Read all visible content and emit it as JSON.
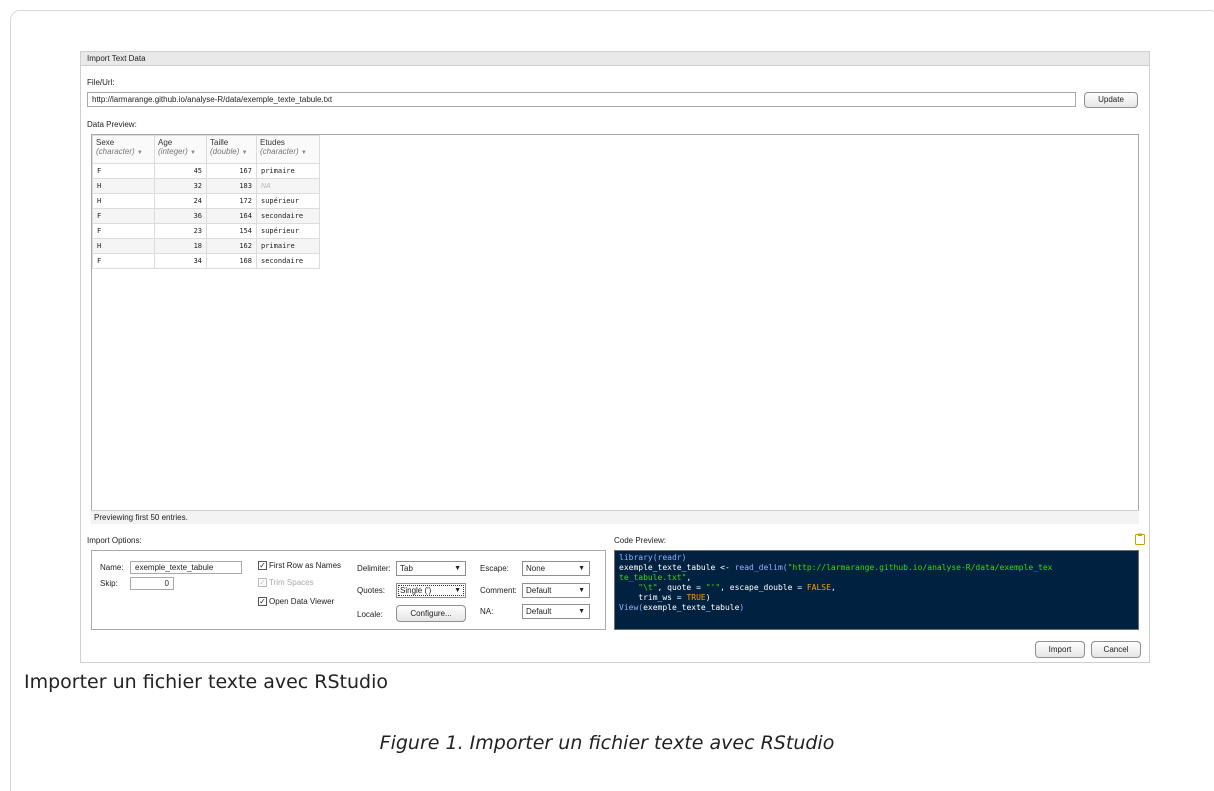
{
  "dialog": {
    "title": "Import Text Data",
    "file_label": "File/Url:",
    "url_value": "http://larmarange.github.io/analyse-R/data/exemple_texte_tabule.txt",
    "update_button": "Update",
    "data_preview_label": "Data Preview:",
    "columns": [
      {
        "name": "Sexe",
        "type": "(character)"
      },
      {
        "name": "Age",
        "type": "(integer)"
      },
      {
        "name": "Taille",
        "type": "(double)"
      },
      {
        "name": "Etudes",
        "type": "(character)"
      }
    ],
    "rows": [
      {
        "sexe": "F",
        "age": "45",
        "taille": "167",
        "etudes": "primaire"
      },
      {
        "sexe": "H",
        "age": "32",
        "taille": "183",
        "etudes": "NA"
      },
      {
        "sexe": "H",
        "age": "24",
        "taille": "172",
        "etudes": "supérieur"
      },
      {
        "sexe": "F",
        "age": "36",
        "taille": "164",
        "etudes": "secondaire"
      },
      {
        "sexe": "F",
        "age": "23",
        "taille": "154",
        "etudes": "supérieur"
      },
      {
        "sexe": "H",
        "age": "18",
        "taille": "162",
        "etudes": "primaire"
      },
      {
        "sexe": "F",
        "age": "34",
        "taille": "168",
        "etudes": "secondaire"
      }
    ],
    "preview_footer": "Previewing first 50 entries.",
    "import_options_label": "Import Options:",
    "name_label": "Name:",
    "name_value": "exemple_texte_tabule",
    "skip_label": "Skip:",
    "skip_value": "0",
    "first_row_label": "First Row as Names",
    "first_row_checked": true,
    "trim_spaces_label": "Trim Spaces",
    "trim_spaces_checked": true,
    "open_viewer_label": "Open Data Viewer",
    "open_viewer_checked": true,
    "delimiter_label": "Delimiter:",
    "delimiter_value": "Tab",
    "quotes_label": "Quotes:",
    "quotes_value": "Single (')",
    "locale_label": "Locale:",
    "configure_button": "Configure...",
    "escape_label": "Escape:",
    "escape_value": "None",
    "comment_label": "Comment:",
    "comment_value": "Default",
    "na_label": "NA:",
    "na_value": "Default",
    "code_preview_label": "Code Preview:",
    "code": {
      "l1": "library(readr)",
      "l2a": "exemple_texte_tabule",
      "l2b": " <- ",
      "l2c": "read_delim(",
      "l2d": "\"http://larmarange.github.io/analyse-R/data/exemple_tex",
      "l3": "te_tabule.txt\"",
      "l3b": ",",
      "l4a": "    \"\\t\"",
      "l4b": ", quote = ",
      "l4c": "\"'\"",
      "l4d": ", escape_double = ",
      "l4e": "FALSE",
      "l4f": ",",
      "l5a": "    trim_ws = ",
      "l5b": "TRUE",
      "l5c": ")",
      "l6a": "View(",
      "l6b": "exemple_texte_tabule",
      "l6c": ")"
    },
    "import_button": "Import",
    "cancel_button": "Cancel"
  },
  "caption_main": "Importer un fichier texte avec RStudio",
  "caption_figure": "Figure 1. Importer un fichier texte avec RStudio"
}
